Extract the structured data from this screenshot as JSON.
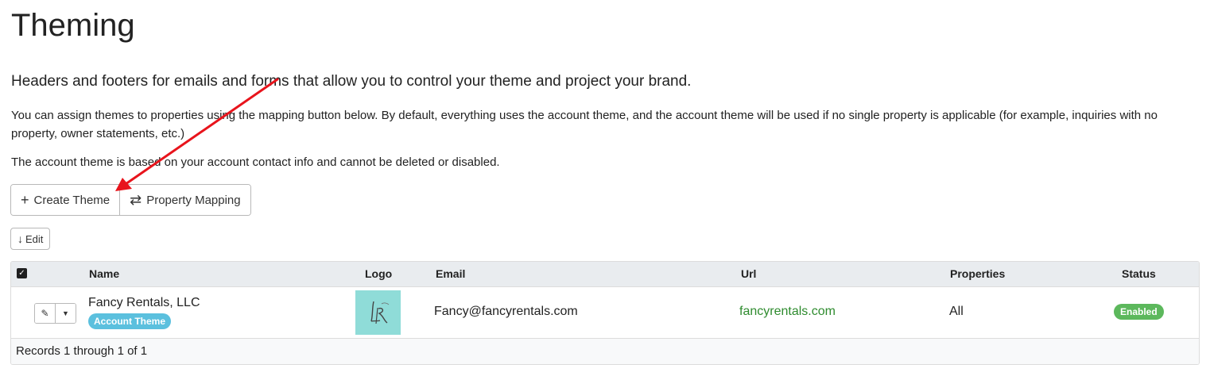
{
  "page": {
    "title": "Theming",
    "lead": "Headers and footers for emails and forms that allow you to control your theme and project your brand.",
    "description": "You can assign themes to properties using the mapping button below. By default, everything uses the account theme, and the account theme will be used if no single property is applicable (for example, inquiries with no property, owner statements, etc.)",
    "note": "The account theme is based on your account contact info and cannot be deleted or disabled."
  },
  "toolbar": {
    "create_icon": "plus-icon",
    "create_label": "Create Theme",
    "mapping_icon": "swap-arrows-icon",
    "mapping_label": "Property Mapping"
  },
  "edit": {
    "icon": "arrow-down-icon",
    "label": "Edit"
  },
  "table": {
    "headers": {
      "name": "Name",
      "logo": "Logo",
      "email": "Email",
      "url": "Url",
      "properties": "Properties",
      "status": "Status"
    },
    "rows": [
      {
        "name": "Fancy Rentals, LLC",
        "badge": "Account Theme",
        "logo_icon": "fancy-rentals-logo",
        "email": "Fancy@fancyrentals.com",
        "url": "fancyrentals.com",
        "properties": "All",
        "status": "Enabled"
      }
    ],
    "footer": "Records 1 through 1 of 1"
  },
  "colors": {
    "badge_account": "#5bc0de",
    "status_enabled": "#5cb85c",
    "url_link": "#2e8b2e",
    "annotation_arrow": "#e8141c",
    "logo_background": "#8fdcd8"
  }
}
